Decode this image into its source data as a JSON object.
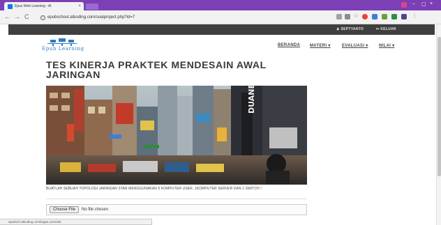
{
  "browser": {
    "tab_title": "Epus Web Learning - Al",
    "tab_close": "×",
    "back": "←",
    "forward": "→",
    "reload": "C",
    "info_glyph": "i",
    "url": "epubschool.atkoding.com/soalproject.php?id=7",
    "status_url": "epubsch.atkoding.com/tugas.com/4eb",
    "win_min": "–",
    "win_max": "▢",
    "win_close": "×",
    "frame_color": "#7c3fb6"
  },
  "site": {
    "user_label": "SEPTYANTO",
    "logout_label": "KELUAR",
    "logo_text": "Epub Learning",
    "menu": {
      "beranda": "BERANDA",
      "materi": "MATERI ▾",
      "evaluasi": "EVALUASI ▾",
      "nilai": "NILAI ▾"
    },
    "title": "TES KINERJA PRAKTEK MENDESAIN AWAL JARINGAN",
    "description": "BUATLAH SEBUAH TOPOLOGI JARINGAN STAR MENGGUNAKAN 5 KOMPUTER USER, 1KOMPUTER SERVER DAN 1 SWITCH !",
    "upload": {
      "button": "Choose File",
      "status": "No file chosen"
    },
    "hero_sign": "DUANE"
  }
}
